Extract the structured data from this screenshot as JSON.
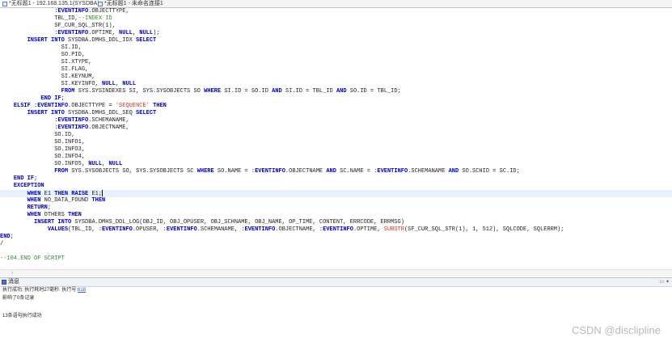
{
  "tabs": [
    {
      "label": "*无标题1 - 192.168.135.1(SYSDBA)",
      "active": true
    },
    {
      "label": "*无标题1 - 未命名连接1",
      "active": false
    }
  ],
  "editor": {
    "lines": [
      [
        [
          "",
          "                :"
        ],
        [
          "kw",
          "EVENTINFO"
        ],
        [
          "",
          ".OBJECTTYPE,"
        ]
      ],
      [
        [
          "",
          "                TBL_ID,"
        ],
        [
          "cmt",
          "--INDEX ID"
        ]
      ],
      [
        [
          "",
          "                SF_CUR_SQL_STR(1),"
        ]
      ],
      [
        [
          "",
          "                :"
        ],
        [
          "kw",
          "EVENTINFO"
        ],
        [
          "",
          ".OPTIME, "
        ],
        [
          "kw",
          "NULL"
        ],
        [
          "",
          ", "
        ],
        [
          "kw",
          "NULL"
        ],
        [
          "",
          ");"
        ]
      ],
      [
        [
          "",
          "        "
        ],
        [
          "kw",
          "INSERT INTO"
        ],
        [
          "",
          " SYSDBA.DMHS_DDL_IDX "
        ],
        [
          "kw",
          "SELECT"
        ]
      ],
      [
        [
          "",
          "                  SI.ID,"
        ]
      ],
      [
        [
          "",
          "                  SO.PID,"
        ]
      ],
      [
        [
          "",
          "                  SI.XTYPE,"
        ]
      ],
      [
        [
          "",
          "                  SI.FLAG,"
        ]
      ],
      [
        [
          "",
          "                  SI.KEYNUM,"
        ]
      ],
      [
        [
          "",
          "                  SI.KEYINFO, "
        ],
        [
          "kw",
          "NULL"
        ],
        [
          "",
          ", "
        ],
        [
          "kw",
          "NULL"
        ]
      ],
      [
        [
          "",
          "                  "
        ],
        [
          "kw",
          "FROM"
        ],
        [
          "",
          " SYS.SYSINDEXES SI, SYS.SYSOBJECTS SO "
        ],
        [
          "kw",
          "WHERE"
        ],
        [
          "",
          " SI.ID = SO.ID "
        ],
        [
          "kw",
          "AND"
        ],
        [
          "",
          " SI.ID = TBL_ID "
        ],
        [
          "kw",
          "AND"
        ],
        [
          "",
          " SO.ID = TBL_ID;"
        ]
      ],
      [
        [
          "",
          "            "
        ],
        [
          "kw",
          "END IF"
        ],
        [
          "",
          ";"
        ]
      ],
      [
        [
          "",
          "    "
        ],
        [
          "kw",
          "ELSIF"
        ],
        [
          "",
          " :"
        ],
        [
          "kw",
          "EVENTINFO"
        ],
        [
          "",
          ".OBJECTTYPE = "
        ],
        [
          "str",
          "'SEQUENCE'"
        ],
        [
          "",
          " "
        ],
        [
          "kw",
          "THEN"
        ]
      ],
      [
        [
          "",
          "        "
        ],
        [
          "kw",
          "INSERT INTO"
        ],
        [
          "",
          " SYSDBA.DMHS_DDL_SEQ "
        ],
        [
          "kw",
          "SELECT"
        ]
      ],
      [
        [
          "",
          "                :"
        ],
        [
          "kw",
          "EVENTINFO"
        ],
        [
          "",
          ".SCHEMANAME,"
        ]
      ],
      [
        [
          "",
          "                :"
        ],
        [
          "kw",
          "EVENTINFO"
        ],
        [
          "",
          ".OBJECTNAME,"
        ]
      ],
      [
        [
          "",
          "                SO.ID,"
        ]
      ],
      [
        [
          "",
          "                SO.INFO1,"
        ]
      ],
      [
        [
          "",
          "                SO.INFO3,"
        ]
      ],
      [
        [
          "",
          "                SO.INFO4,"
        ]
      ],
      [
        [
          "",
          "                SO.INFO5, "
        ],
        [
          "kw",
          "NULL"
        ],
        [
          "",
          ", "
        ],
        [
          "kw",
          "NULL"
        ]
      ],
      [
        [
          "",
          "                "
        ],
        [
          "kw",
          "FROM"
        ],
        [
          "",
          " SYS.SYSOBJECTS SO, SYS.SYSOBJECTS SC "
        ],
        [
          "kw",
          "WHERE"
        ],
        [
          "",
          " SO.NAME = :"
        ],
        [
          "kw",
          "EVENTINFO"
        ],
        [
          "",
          ".OBJECTNAME "
        ],
        [
          "kw",
          "AND"
        ],
        [
          "",
          " SC.NAME = :"
        ],
        [
          "kw",
          "EVENTINFO"
        ],
        [
          "",
          ".SCHEMANAME "
        ],
        [
          "kw",
          "AND"
        ],
        [
          "",
          " SO.SCHID = SC.ID;"
        ]
      ],
      [
        [
          "",
          "    "
        ],
        [
          "kw",
          "END IF"
        ],
        [
          "",
          ";"
        ]
      ],
      [
        [
          "",
          "    "
        ],
        [
          "kw",
          "EXCEPTION"
        ]
      ],
      [
        [
          "",
          "        "
        ],
        [
          "kw",
          "WHEN"
        ],
        [
          "",
          " E1 "
        ],
        [
          "kw",
          "THEN RAISE"
        ],
        [
          "",
          " E1;"
        ],
        [
          "cursor",
          ""
        ]
      ],
      [
        [
          "",
          "        "
        ],
        [
          "kw",
          "WHEN"
        ],
        [
          "",
          " NO_DATA_FOUND "
        ],
        [
          "kw",
          "THEN"
        ]
      ],
      [
        [
          "",
          "        "
        ],
        [
          "kw",
          "RETURN"
        ],
        [
          "",
          ";"
        ]
      ],
      [
        [
          "",
          "        "
        ],
        [
          "kw",
          "WHEN"
        ],
        [
          "",
          " OTHERS "
        ],
        [
          "kw",
          "THEN"
        ]
      ],
      [
        [
          "",
          "          "
        ],
        [
          "kw",
          "INSERT INTO"
        ],
        [
          "",
          " SYSDBA.DMHS_DDL_LOG(OBJ_ID, OBJ_OPUSER, OBJ_SCHNAME, OBJ_NAME, OP_TIME, CONTENT, ERRCODE, ERRMSG)"
        ]
      ],
      [
        [
          "",
          "              "
        ],
        [
          "kw",
          "VALUES"
        ],
        [
          "",
          "(TBL_ID, :"
        ],
        [
          "kw",
          "EVENTINFO"
        ],
        [
          "",
          ".OPUSER, :"
        ],
        [
          "kw",
          "EVENTINFO"
        ],
        [
          "",
          ".SCHEMANAME, :"
        ],
        [
          "kw",
          "EVENTINFO"
        ],
        [
          "",
          ".OBJECTNAME, :"
        ],
        [
          "kw",
          "EVENTINFO"
        ],
        [
          "",
          ".OPTIME, "
        ],
        [
          "str",
          "SUBSTR"
        ],
        [
          "",
          "(SF_CUR_SQL_STR(1), 1, 512), SQLCODE, SQLERRM);"
        ]
      ],
      [
        [
          "kw",
          "END"
        ],
        [
          "",
          ";"
        ]
      ],
      [
        [
          "",
          "/"
        ]
      ],
      [
        [
          "",
          ""
        ]
      ],
      [
        [
          "cmt",
          "--104.END OF SCRIPT"
        ]
      ]
    ],
    "current_line": 25
  },
  "messages": {
    "panel_title": "消息",
    "exec_status": "执行成功,  执行耗时27毫秒.  执行号:",
    "exec_number": "618",
    "affected": "影响了0条记录",
    "summary": "13条语句执行成功"
  },
  "watermark": "CSDN @disclipline",
  "colors": {
    "keyword": "#0000c8",
    "string": "#c0392b",
    "comment": "#2e8b2e",
    "current_line": "#e8f2fe"
  }
}
